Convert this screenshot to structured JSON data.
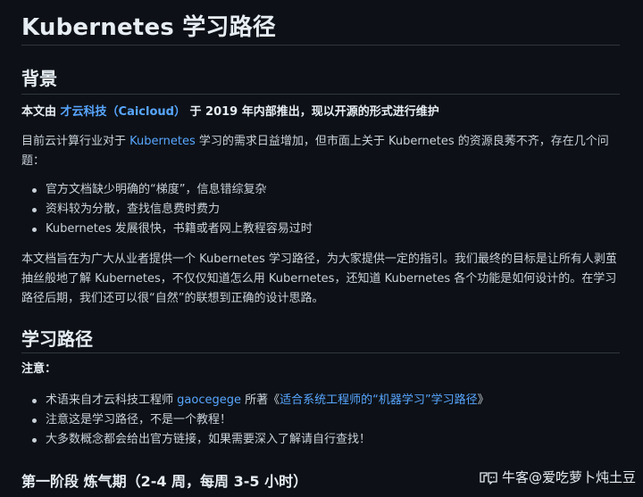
{
  "title": "Kubernetes 学习路径",
  "background": {
    "heading": "背景",
    "lead_prefix": "本文由 ",
    "lead_link": "才云科技（Caicloud）",
    "lead_suffix": " 于 2019 年内部推出，现以开源的形式进行维护",
    "p1_prefix": "目前云计算行业对于 ",
    "p1_link": "Kubernetes",
    "p1_suffix": " 学习的需求日益增加，但市面上关于 Kubernetes 的资源良莠不齐，存在几个问题：",
    "bullets": [
      "官方文档缺少明确的“梯度”，信息错综复杂",
      "资料较为分散，查找信息费时费力",
      "Kubernetes 发展很快，书籍或者网上教程容易过时"
    ],
    "p2": "本文档旨在为广大从业者提供一个 Kubernetes 学习路径，为大家提供一定的指引。我们最终的目标是让所有人剥茧抽丝般地了解 Kubernetes，不仅仅知道怎么用 Kubernetes，还知道 Kubernetes 各个功能是如何设计的。在学习路径后期，我们还可以很“自然”的联想到正确的设计思路。"
  },
  "path": {
    "heading": "学习路径",
    "note_label": "注意：",
    "b1_prefix": "术语来自才云科技工程师 ",
    "b1_link1": "gaocegege",
    "b1_mid": " 所著《",
    "b1_link2": "适合系统工程师的“机器学习”学习路径",
    "b1_suffix": "》",
    "b2": "注意这是学习路径，不是一个教程！",
    "b3": "大多数概念都会给出官方链接，如果需要深入了解请自行查找！"
  },
  "stage1": {
    "heading": "第一阶段 炼气期（2-4 周，每周 3-5 小时）"
  },
  "watermark": {
    "icon": "niuke-logo-icon",
    "text": "牛客@爱吃萝卜炖土豆"
  }
}
